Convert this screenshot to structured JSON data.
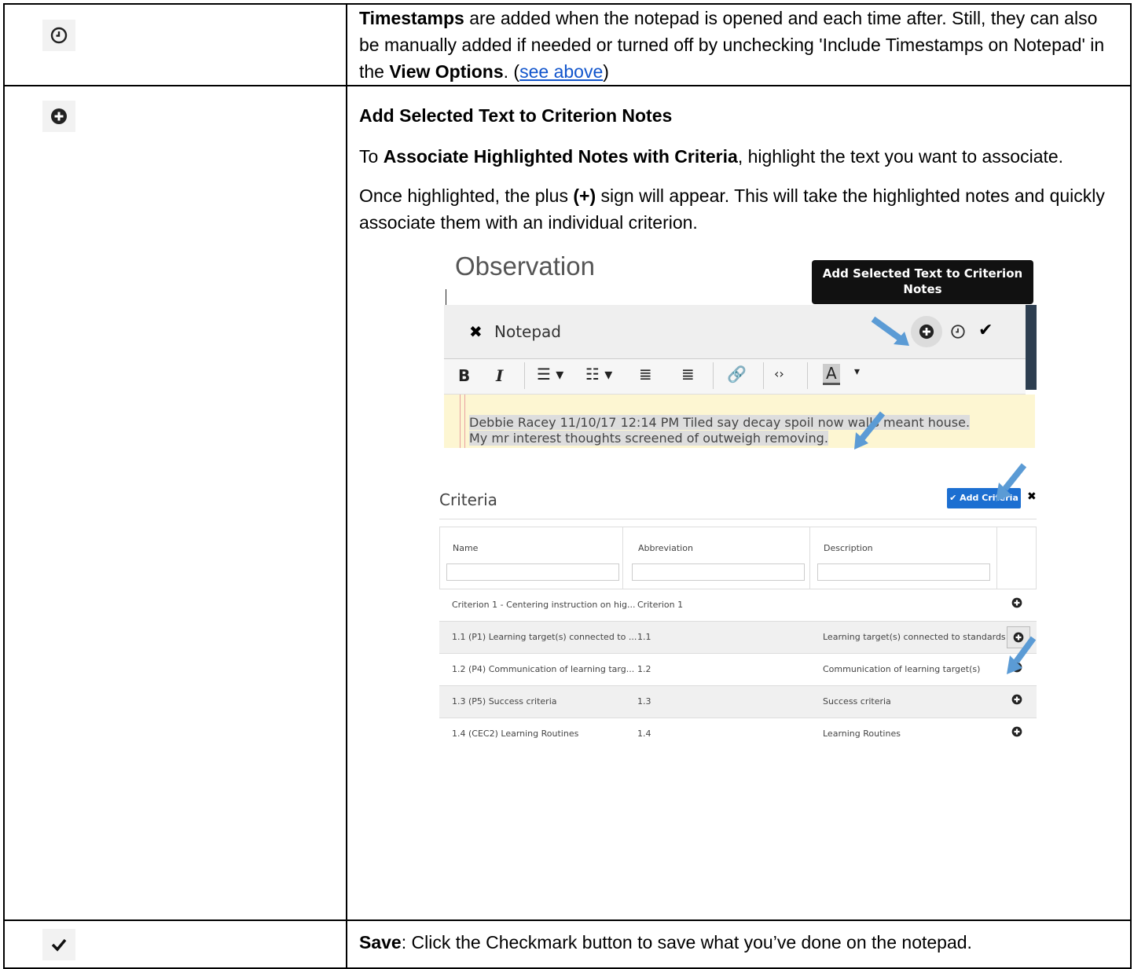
{
  "rows": [
    {
      "icon": "clock-icon",
      "text": {
        "timestamps_bold": "Timestamps",
        "part1": " are added when the notepad is opened and each time after. Still, they can also be manually added if needed or turned off by unchecking 'Include Timestamps on Notepad' in the ",
        "view_options_bold": "View Options",
        "part2": ". (",
        "link": "see above",
        "part3": ")"
      }
    },
    {
      "icon": "plus-circle-icon",
      "heading": "Add Selected Text to Criterion Notes",
      "p1": {
        "pre": "To ",
        "bold": "Associate Highlighted Notes with Criteria",
        "post": ", highlight the text you want to associate."
      },
      "p2": {
        "pre": "Once highlighted, the plus ",
        "bold": "(+)",
        "post": " sign will appear. This will take the highlighted notes and quickly associate them with an individual criterion."
      }
    },
    {
      "icon": "checkmark-icon",
      "text": {
        "bold": "Save",
        "rest": ": Click the Checkmark button to save what you’ve done on the notepad."
      }
    }
  ],
  "screenshot": {
    "title": "Observation",
    "tooltip": "Add Selected Text to Criterion Notes",
    "notepad_label": "Notepad",
    "note_text_line1": "Debbie Racey 11/10/17 12:14 PM Tiled say decay spoil now walls meant house.",
    "note_text_line2": "My mr interest thoughts screened of outweigh removing.",
    "criteria_title": "Criteria",
    "add_criteria_label": "✔ Add Criteria",
    "columns": [
      "Name",
      "Abbreviation",
      "Description"
    ],
    "criteria_rows": [
      {
        "name": "Criterion 1 - Centering instruction on hig...",
        "abbr": "Criterion 1",
        "desc": ""
      },
      {
        "name": "1.1 (P1) Learning target(s) connected to ...",
        "abbr": "1.1",
        "desc": "Learning target(s) connected to standards"
      },
      {
        "name": "1.2 (P4) Communication of learning targ...",
        "abbr": "1.2",
        "desc": "Communication of learning target(s)"
      },
      {
        "name": "1.3 (P5) Success criteria",
        "abbr": "1.3",
        "desc": "Success criteria"
      },
      {
        "name": "1.4 (CEC2) Learning Routines",
        "abbr": "1.4",
        "desc": "Learning Routines"
      }
    ]
  }
}
